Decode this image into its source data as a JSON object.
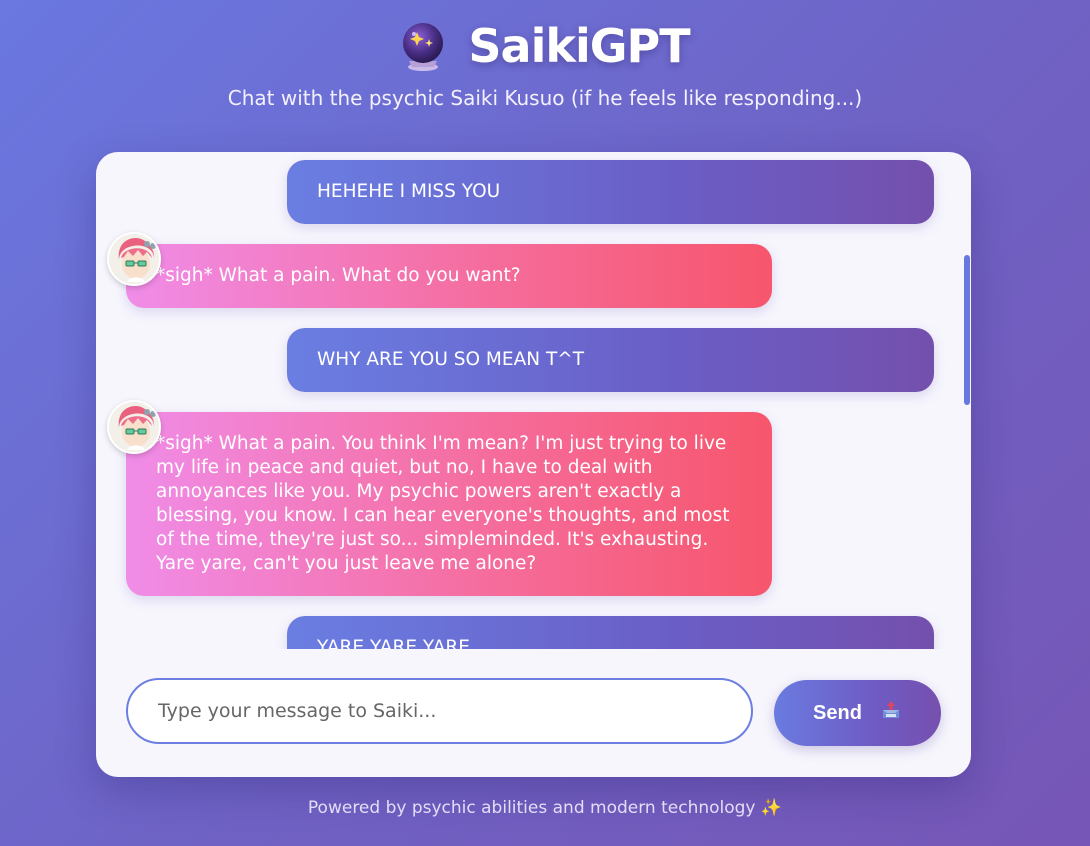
{
  "app": {
    "title": "SaikiGPT",
    "logo_icon": "crystal-ball-icon",
    "subtitle": "Chat with the psychic Saiki Kusuo (if he feels like responding...)"
  },
  "messages": [
    {
      "sender": "user",
      "text": "HEHEHE I MISS YOU"
    },
    {
      "sender": "saiki",
      "text": "*sigh* What a pain. What do you want?"
    },
    {
      "sender": "user",
      "text": "WHY ARE YOU SO MEAN T^T"
    },
    {
      "sender": "saiki",
      "text": "*sigh* What a pain. You think I'm mean? I'm just trying to live my life in peace and quiet, but no, I have to deal with annoyances like you. My psychic powers aren't exactly a blessing, you know. I can hear everyone's thoughts, and most of the time, they're just so... simpleminded. It's exhausting. Yare yare, can't you just leave me alone?"
    },
    {
      "sender": "user",
      "text": "YARE YARE YARE"
    }
  ],
  "input": {
    "placeholder": "Type your message to Saiki...",
    "value": ""
  },
  "send_button": {
    "label": "Send",
    "icon": "outbox-tray-icon"
  },
  "footer": {
    "text": "Powered by psychic abilities and modern technology",
    "icon": "sparkles-icon",
    "icon_glyph": "✨"
  },
  "colors": {
    "background_start": "#6a78e0",
    "background_end": "#7656b6",
    "user_bubble_start": "#6a7ee2",
    "user_bubble_end": "#7450ad",
    "saiki_bubble_start": "#f08ce8",
    "saiki_bubble_end": "#f7566c",
    "accent": "#6d7fe0"
  }
}
